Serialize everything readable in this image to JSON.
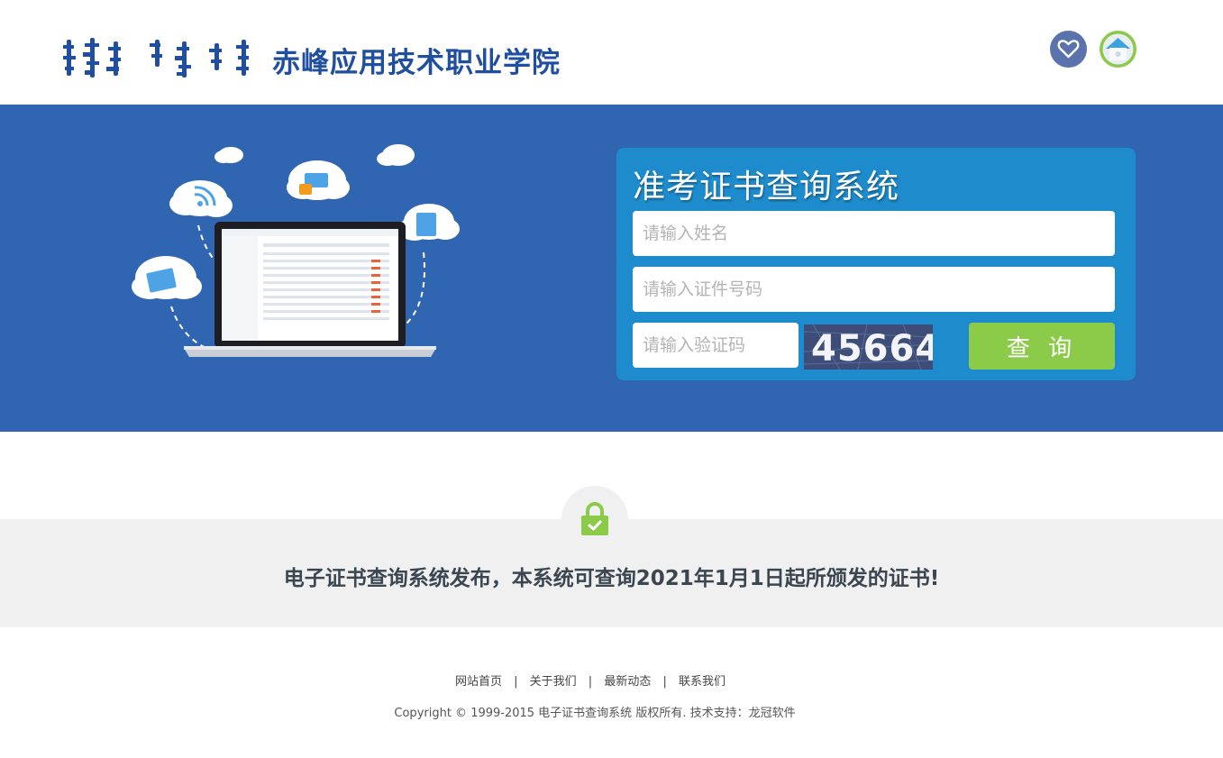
{
  "header": {
    "school_name": "赤峰应用技术职业学院",
    "favorite_icon": "heart-icon",
    "home_icon": "home-icon"
  },
  "login_panel": {
    "title": "准考证书查询系统",
    "name_placeholder": "请输入姓名",
    "id_placeholder": "请输入证件号码",
    "captcha_placeholder": "请输入验证码",
    "captcha_code": "45664",
    "submit_label": "查 询"
  },
  "notice": {
    "icon": "lock-check-icon",
    "text": "电子证书查询系统发布，本系统可查询2021年1月1日起所颁发的证书!"
  },
  "footer": {
    "links": [
      "网站首页",
      "关于我们",
      "最新动态",
      "联系我们"
    ],
    "separator": "|",
    "copyright": "Copyright © 1999-2015 电子证书查询系统 版权所有. 技术支持：龙冠软件"
  },
  "colors": {
    "banner_bg": "#3066b1",
    "panel_bg": "#1e8ccc",
    "submit_bg": "#8ccb4a",
    "school_name": "#1f4f9e",
    "notice_bg": "#f0f0f0"
  }
}
